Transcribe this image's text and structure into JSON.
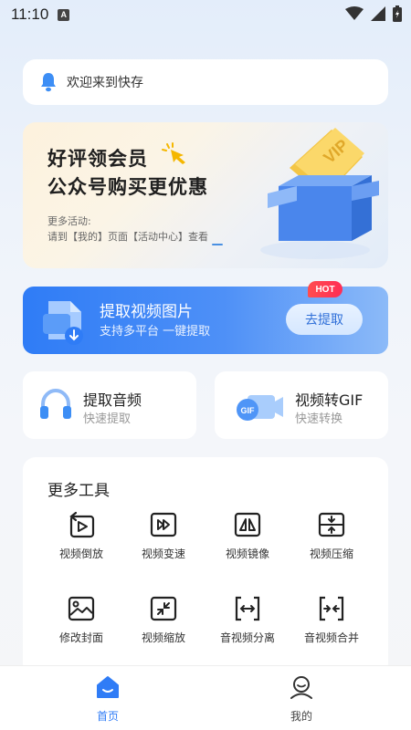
{
  "status_bar": {
    "time": "11:10",
    "a_icon": "A"
  },
  "notice": {
    "text": "欢迎来到快存",
    "icon": "bell-icon"
  },
  "banner": {
    "title_line1": "好评领会员",
    "title_line2": "公众号购买更优惠",
    "sub_line1": "更多活动:",
    "sub_line2": "请到【我的】页面【活动中心】查看",
    "box_label": "VIP"
  },
  "extract": {
    "title": "提取视频图片",
    "subtitle": "支持多平台 一键提取",
    "button": "去提取",
    "badge": "HOT"
  },
  "audio_card": {
    "title": "提取音频",
    "subtitle": "快速提取"
  },
  "gif_card": {
    "title": "视频转GIF",
    "subtitle": "快速转换",
    "icon_text": "GIF"
  },
  "tools": {
    "heading": "更多工具",
    "items": [
      {
        "label": "视频倒放",
        "icon": "reverse-icon"
      },
      {
        "label": "视频变速",
        "icon": "speed-icon"
      },
      {
        "label": "视频镜像",
        "icon": "mirror-icon"
      },
      {
        "label": "视频压缩",
        "icon": "compress-icon"
      },
      {
        "label": "修改封面",
        "icon": "cover-icon"
      },
      {
        "label": "视频缩放",
        "icon": "zoom-icon"
      },
      {
        "label": "音视频分离",
        "icon": "split-icon"
      },
      {
        "label": "音视频合并",
        "icon": "merge-icon"
      }
    ]
  },
  "tabbar": {
    "home": "首页",
    "mine": "我的"
  },
  "colors": {
    "accent": "#2f7cf6",
    "hot": "#ff3b4f"
  }
}
